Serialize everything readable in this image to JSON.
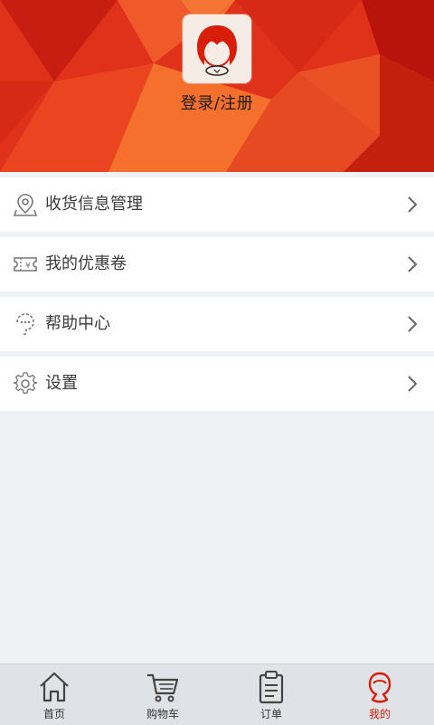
{
  "header": {
    "login_label": "登录/注册",
    "bg_color": "#e2331a"
  },
  "menu": {
    "items": [
      {
        "label": "收货信息管理",
        "icon": "location-pin-icon"
      },
      {
        "label": "我的优惠卷",
        "icon": "coupon-icon"
      },
      {
        "label": "帮助中心",
        "icon": "help-icon"
      },
      {
        "label": "设置",
        "icon": "gear-icon"
      }
    ]
  },
  "tabbar": {
    "tabs": [
      {
        "label": "首页",
        "icon": "home-icon",
        "active": false
      },
      {
        "label": "购物车",
        "icon": "cart-icon",
        "active": false
      },
      {
        "label": "订单",
        "icon": "clipboard-icon",
        "active": false
      },
      {
        "label": "我的",
        "icon": "profile-icon",
        "active": true
      }
    ],
    "active_color": "#d81e06"
  }
}
